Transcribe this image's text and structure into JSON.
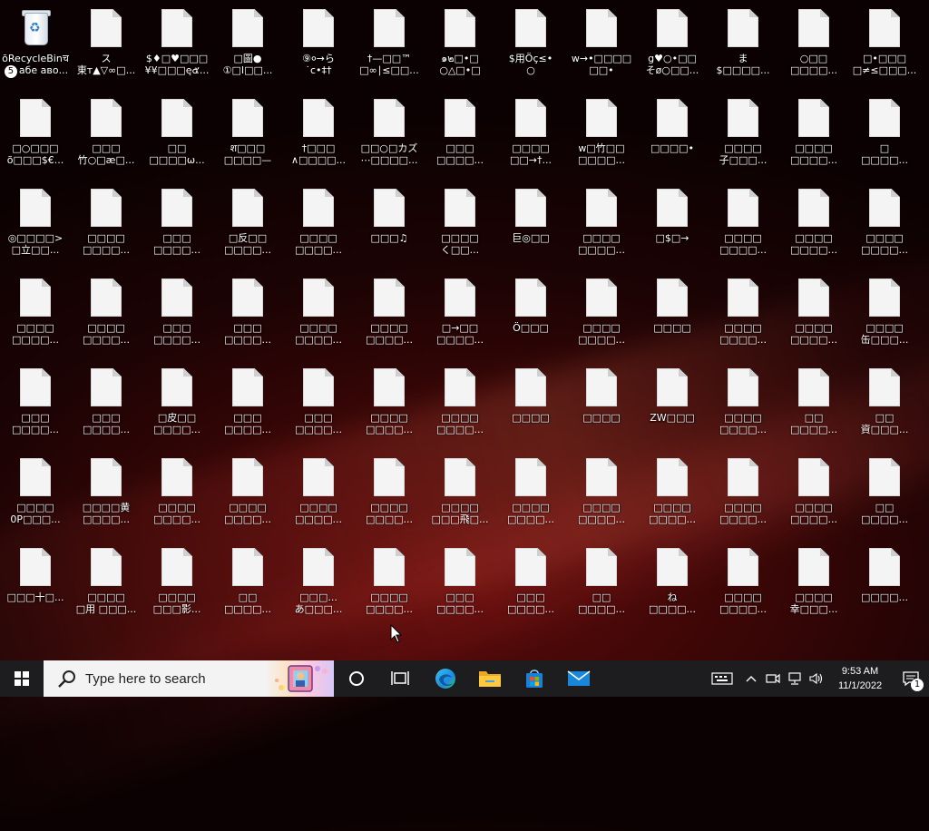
{
  "desktop": {
    "recycle_bin": {
      "label_line1": "ōRecycleBinच",
      "label_line2": "абе аво...",
      "badge": "5"
    },
    "files": [
      [
        "ス",
        "東т▲▽∞□..."
      ],
      [
        "$♦□♥□□□",
        "¥¥□□□ę๕..."
      ],
      [
        "□圖●",
        "①□Ⅰ□□..."
      ],
      [
        "⑨०→ら",
        "˙с•‡†"
      ],
      [
        "†—□□™",
        "□∞∣≤□□..."
      ],
      [
        "๑๒□•□",
        "○△□•□"
      ],
      [
        "$用Öç≤•",
        "○"
      ],
      [
        "w→•□□□□",
        "□□•"
      ],
      [
        "g♥○•□□",
        "そø○□□..."
      ],
      [
        "ま",
        "$□□□□..."
      ],
      [
        "○□□",
        "□□□□..."
      ],
      [
        "□•□□□",
        "□≠≤□□□..."
      ],
      [
        "□○□□□",
        "õ□□□$€..."
      ],
      [
        "□□□",
        "竹○□æ□..."
      ],
      [
        "□□",
        "□□□□ω..."
      ],
      [
        "श□□□",
        "□□□□—"
      ],
      [
        "†□□□",
        "∧□□□□..."
      ],
      [
        "□□○□カズ",
        "⋯□□□□..."
      ],
      [
        "□□□",
        "□□□□..."
      ],
      [
        "□□□□",
        "□□→†..."
      ],
      [
        "w□竹□□",
        "□□□□..."
      ],
      [
        "□□□□•",
        ""
      ],
      [
        "□□□□",
        "子□□□..."
      ],
      [
        "□□□□",
        "□□□□..."
      ],
      [
        "□",
        "□□□□..."
      ],
      [
        "◎□□□□>",
        "□立□□..."
      ],
      [
        "□□□□",
        "□□□□..."
      ],
      [
        "□□□",
        "□□□□..."
      ],
      [
        "□反□□",
        "□□□□..."
      ],
      [
        "□□□□",
        "□□□□..."
      ],
      [
        "□□□♫",
        ""
      ],
      [
        "□□□□",
        "く□□..."
      ],
      [
        "巨◎□□",
        ""
      ],
      [
        "□□□□",
        "□□□□..."
      ],
      [
        "□$□→",
        ""
      ],
      [
        "□□□□",
        "□□□□..."
      ],
      [
        "□□□□",
        "□□□□..."
      ],
      [
        "□□□□",
        "□□□□..."
      ],
      [
        "□□□□",
        "□□□□..."
      ],
      [
        "□□□□",
        "□□□□..."
      ],
      [
        "□□□",
        "□□□□..."
      ],
      [
        "□□□",
        "□□□□..."
      ],
      [
        "□□□□",
        "□□□□..."
      ],
      [
        "□□□□",
        "□□□□..."
      ],
      [
        "□→□□",
        "□□□□..."
      ],
      [
        "Ö□□□",
        ""
      ],
      [
        "□□□□",
        "□□□□..."
      ],
      [
        "□□□□",
        ""
      ],
      [
        "□□□□",
        "□□□□..."
      ],
      [
        "□□□□",
        "□□□□..."
      ],
      [
        "□□□□",
        "缶□□□..."
      ],
      [
        "□□□",
        "□□□□..."
      ],
      [
        "□□□",
        "□□□□..."
      ],
      [
        "□皮□□",
        "□□□□..."
      ],
      [
        "□□□",
        "□□□□..."
      ],
      [
        "□□□",
        "□□□□..."
      ],
      [
        "□□□□",
        "□□□□..."
      ],
      [
        "□□□□",
        "□□□□..."
      ],
      [
        "□□□□",
        ""
      ],
      [
        "□□□□",
        ""
      ],
      [
        "ZW□□□",
        ""
      ],
      [
        "□□□□",
        "□□□□..."
      ],
      [
        "□□",
        "□□□□..."
      ],
      [
        "□□",
        "資□□□..."
      ],
      [
        "□□□□",
        "0P□□□..."
      ],
      [
        "□□□□黄",
        "□□□□..."
      ],
      [
        "□□□□",
        "□□□□..."
      ],
      [
        "□□□□",
        "□□□□..."
      ],
      [
        "□□□□",
        "□□□□..."
      ],
      [
        "□□□□",
        "□□□□..."
      ],
      [
        "□□□□",
        "□□□飛□..."
      ],
      [
        "□□□□",
        "□□□□..."
      ],
      [
        "□□□□",
        "□□□□..."
      ],
      [
        "□□□□",
        "□□□□..."
      ],
      [
        "□□□□",
        "□□□□..."
      ],
      [
        "□□□□",
        "□□□□..."
      ],
      [
        "□□",
        "□□□□..."
      ],
      [
        "□□□十□...",
        ""
      ],
      [
        "□□□□",
        "□用 □□□..."
      ],
      [
        "□□□□",
        "□□□影..."
      ],
      [
        "□□",
        "□□□□..."
      ],
      [
        "□□□...",
        "あ□□□..."
      ],
      [
        "□□□□",
        "□□□□..."
      ],
      [
        "□□□",
        "□□□□..."
      ],
      [
        "□□□",
        "□□□□..."
      ],
      [
        "□□",
        "□□□□..."
      ],
      [
        "ね",
        "□□□□..."
      ],
      [
        "□□□□",
        "□□□□..."
      ],
      [
        "□□□□",
        "幸□□□..."
      ],
      [
        "□□□□...",
        ""
      ]
    ]
  },
  "taskbar": {
    "search_placeholder": "Type here to search",
    "time": "9:53 AM",
    "date": "11/1/2022",
    "notification_count": "1"
  },
  "colors": {
    "taskbar": "#1d1d1f",
    "search_bg": "#f3f3f3",
    "accent": "#0078d4"
  }
}
